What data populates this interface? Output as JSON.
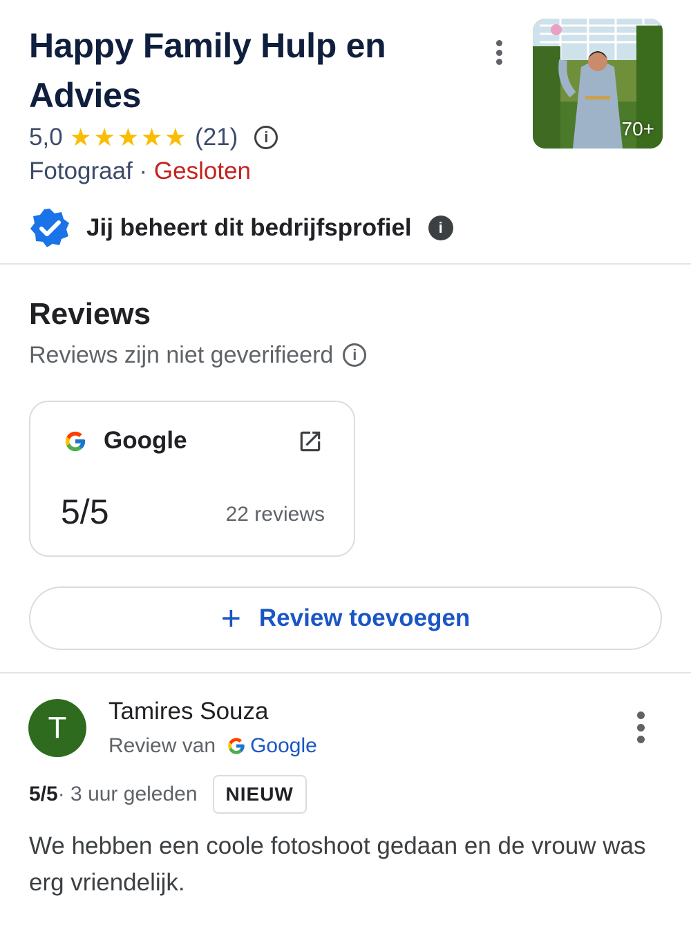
{
  "business": {
    "name": "Happy Family Hulp en Advies",
    "rating": "5,0",
    "rating_count": "(21)",
    "category": "Fotograaf",
    "separator": " · ",
    "status": "Gesloten",
    "photo_count": "70+",
    "managed_text": "Jij beheert dit bedrijfsprofiel"
  },
  "reviews": {
    "heading": "Reviews",
    "subtitle": "Reviews zijn niet geverifieerd",
    "google_card": {
      "source": "Google",
      "score": "5/5",
      "count": "22 reviews"
    },
    "add_button_label": "Review toevoegen"
  },
  "review": {
    "avatar_letter": "T",
    "author": "Tamires Souza",
    "source_prefix": "Review van",
    "source_name": "Google",
    "score": "5/5",
    "time": " · 3 uur geleden",
    "badge": "NIEUW",
    "text": "We hebben een coole fotoshoot gedaan en de vrouw was erg vriendelijk."
  },
  "colors": {
    "star": "#fbbc04",
    "closed": "#c5221f",
    "link": "#1a56c4",
    "verified": "#1a73e8",
    "avatar": "#2e6b1e"
  },
  "icons": [
    "more-vert-icon",
    "star-icon",
    "info-icon",
    "verified-badge-icon",
    "google-logo-icon",
    "open-in-new-icon",
    "plus-icon"
  ]
}
